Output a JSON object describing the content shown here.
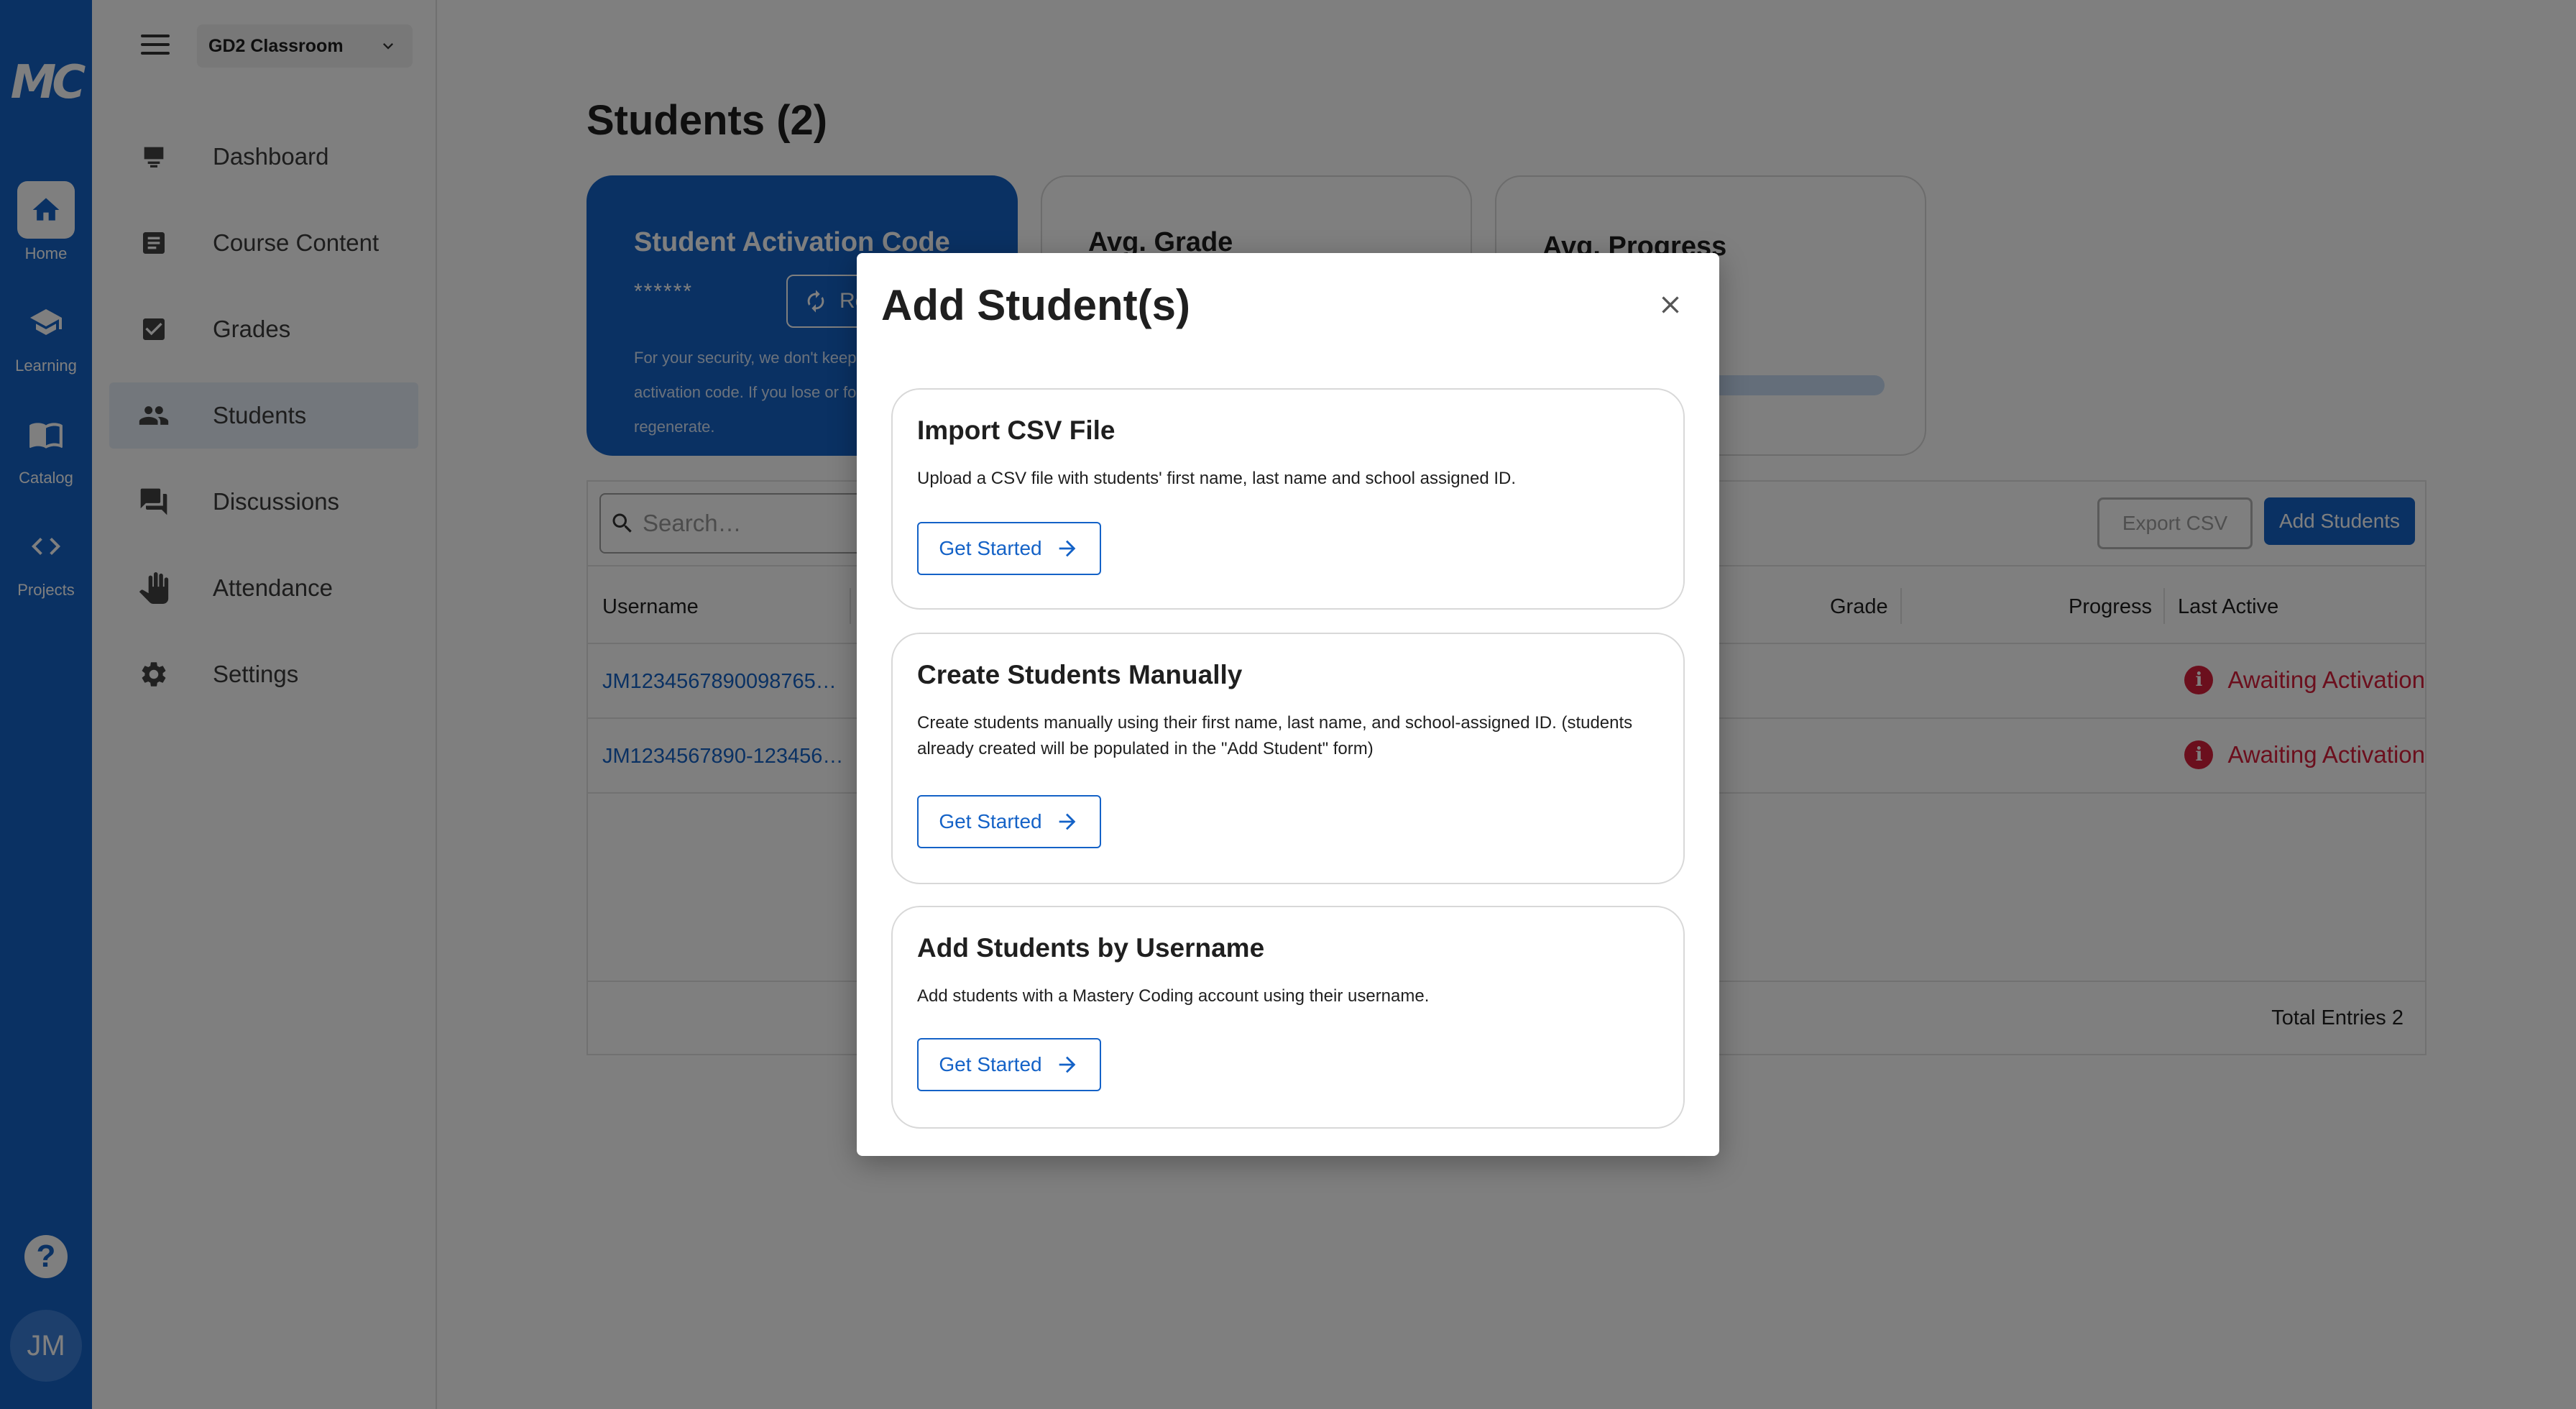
{
  "rail": {
    "logo": "MC",
    "items": [
      {
        "label": "Home",
        "icon": "home-icon"
      },
      {
        "label": "Learning",
        "icon": "graduation-cap-icon"
      },
      {
        "label": "Catalog",
        "icon": "book-icon"
      },
      {
        "label": "Projects",
        "icon": "code-icon"
      }
    ],
    "help_label": "?",
    "avatar_initials": "JM"
  },
  "sidebar": {
    "class_name": "GD2 Classroom",
    "items": [
      {
        "label": "Dashboard",
        "icon": "dashboard-icon"
      },
      {
        "label": "Course Content",
        "icon": "document-icon"
      },
      {
        "label": "Grades",
        "icon": "checkbox-icon"
      },
      {
        "label": "Students",
        "icon": "people-icon"
      },
      {
        "label": "Discussions",
        "icon": "chat-icon"
      },
      {
        "label": "Attendance",
        "icon": "hand-icon"
      },
      {
        "label": "Settings",
        "icon": "gear-icon"
      }
    ],
    "active_index": 3
  },
  "main": {
    "title": "Students (2)",
    "activation_card": {
      "title": "Student Activation Code",
      "code": "******",
      "regen_label": "Regenerate",
      "note": "For your security, we don't keep a copy of your activation code. If you lose or forget it, please regenerate."
    },
    "grade_card": {
      "title": "Avg. Grade"
    },
    "progress_card": {
      "title": "Avg. Progress",
      "progress": 0.05
    },
    "search": {
      "placeholder": "Search…"
    },
    "export_label": "Export CSV",
    "add_label": "Add Students",
    "columns": {
      "username": "Username",
      "grade": "Grade",
      "progress": "Progress",
      "last_active": "Last Active"
    },
    "rows": [
      {
        "username": "JM1234567890098765…",
        "status": "Awaiting Activation"
      },
      {
        "username": "JM1234567890-123456…",
        "status": "Awaiting Activation"
      }
    ],
    "total_entries": "Total Entries 2"
  },
  "modal": {
    "title": "Add Student(s)",
    "options": [
      {
        "title": "Import CSV File",
        "desc": "Upload a CSV file with students' first name, last name and school assigned ID.",
        "button": "Get Started"
      },
      {
        "title": "Create Students Manually",
        "desc": "Create students manually using their first name, last name, and school-assigned ID. (students already created will be populated in the \"Add Student\" form)",
        "button": "Get Started"
      },
      {
        "title": "Add Students by Username",
        "desc": "Add students with a Mastery Coding account using their username.",
        "button": "Get Started"
      }
    ]
  },
  "colors": {
    "brand": "#1462c7",
    "error": "#d61f3a",
    "overlay": "rgba(0,0,0,0.5)"
  }
}
